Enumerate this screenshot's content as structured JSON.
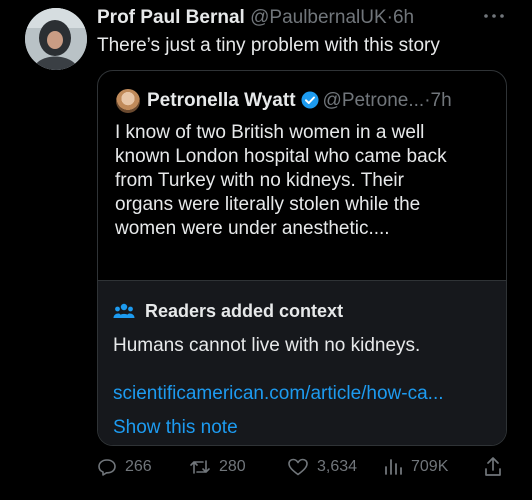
{
  "tweet": {
    "author_name": "Prof Paul Bernal",
    "author_handle": "@PaulbernalUK",
    "separator": "·",
    "time": "6h",
    "text": "There’s just a tiny problem with this story",
    "more_icon": "more-dots-icon"
  },
  "quote": {
    "author_name": "Petronella Wyatt",
    "author_handle": "@Petrone...",
    "separator": "·",
    "time": "7h",
    "verified_icon": "verified-badge-icon",
    "verified_color": "#1d9bf0",
    "lines": [
      "I know of two British women in a well",
      "known London hospital who came back",
      "from Turkey with no kidneys. Their",
      "organs were literally stolen while the",
      "women were under anesthetic...."
    ]
  },
  "context": {
    "title": "Readers added context",
    "body": "Humans cannot live with no kidneys.",
    "link": "scientificamerican.com/article/how-ca...",
    "show_note": "Show this note",
    "link_color": "#1d9bf0"
  },
  "actions": {
    "replies": "266",
    "retweets": "280",
    "likes": "3,634",
    "views": "709K"
  }
}
